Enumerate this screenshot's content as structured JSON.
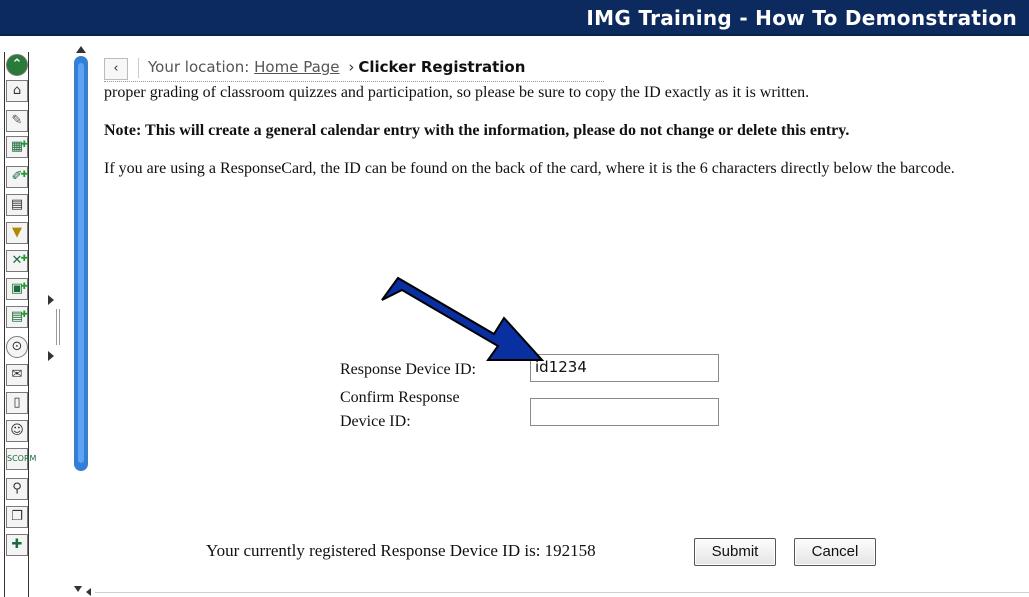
{
  "window": {
    "title": "IMG Training - How To Demonstration"
  },
  "breadcrumb": {
    "prefix": "Your location:",
    "home_link": "Home Page",
    "separator": "›",
    "current": "Clicker Registration"
  },
  "content": {
    "para1": "proper grading of classroom quizzes and participation, so please be sure to copy the ID exactly as it is written.",
    "note": "Note: This will create a general calendar entry with the information, please do not change or delete this entry.",
    "para2": "If you are using a ResponseCard, the ID can be found on the back of the card, where it is the 6 characters directly below the barcode."
  },
  "form": {
    "device_id_label": "Response Device ID:",
    "device_id_value": "id1234",
    "confirm_label_line1": "Confirm Response",
    "confirm_label_line2": "Device ID:",
    "confirm_value": ""
  },
  "footer": {
    "registered_text": "Your currently registered Response Device ID is: 192158",
    "submit_label": "Submit",
    "cancel_label": "Cancel"
  },
  "toolbar": {
    "icons": [
      "collapse-icon",
      "home-icon",
      "announcements-icon",
      "add-calendar-icon",
      "add-tool-icon",
      "syllabus-icon",
      "discussion-icon",
      "add-assignment-icon",
      "add-content-icon",
      "add-page-icon",
      "clock-icon",
      "mail-icon",
      "document-icon",
      "groups-icon",
      "scorm-icon",
      "search-icon",
      "copy-icon",
      "more-tools-icon"
    ]
  },
  "colors": {
    "titlebar_bg": "#0d2a5e",
    "arrow_fill": "#0a2fa0",
    "scrollbar": "#2f7fe0"
  }
}
